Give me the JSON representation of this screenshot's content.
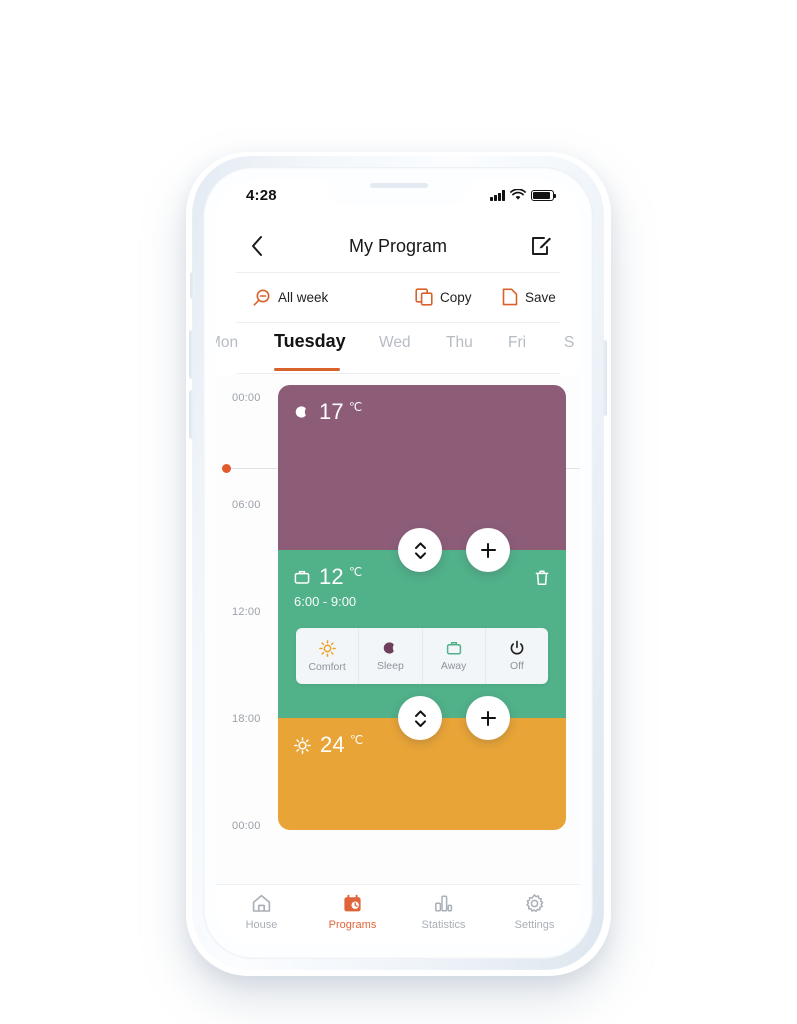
{
  "statusbar": {
    "time": "4:28",
    "signal_icon": "cellular-signal-icon",
    "wifi_icon": "wifi-icon",
    "battery_icon": "battery-icon"
  },
  "header": {
    "back_icon": "chevron-left-icon",
    "title": "My Program",
    "edit_icon": "edit-pencil-square-icon"
  },
  "toolbar": {
    "accent_color": "#d9622b",
    "items": [
      {
        "label": "All week",
        "icon": "zoom-out-magnifier-icon"
      },
      {
        "label": "Copy",
        "icon": "copy-icon"
      },
      {
        "label": "Save",
        "icon": "save-document-icon"
      }
    ]
  },
  "day_tabs": {
    "active_index": 1,
    "underline_color": "#d9622b",
    "items": [
      {
        "label": "Mon"
      },
      {
        "label": "Tuesday"
      },
      {
        "label": "Wed"
      },
      {
        "label": "Thu"
      },
      {
        "label": "Fri"
      },
      {
        "label": "S"
      }
    ]
  },
  "schedule": {
    "axis_labels": [
      "00:00",
      "06:00",
      "12:00",
      "18:00",
      "00:00"
    ],
    "now_indicator": {
      "dot_color": "#e3592a"
    },
    "blocks": [
      {
        "mode": "Sleep",
        "icon": "moon-icon",
        "temperature": "17",
        "unit": "℃",
        "color": "#8d5d78",
        "range": ""
      },
      {
        "mode": "Away",
        "icon": "briefcase-icon",
        "temperature": "12",
        "unit": "℃",
        "color": "#51b189",
        "range": "6:00 - 9:00",
        "delete_icon": "trash-icon"
      },
      {
        "mode": "Comfort",
        "icon": "sun-icon",
        "temperature": "24",
        "unit": "℃",
        "color": "#e8a437",
        "range": ""
      }
    ],
    "handles": {
      "drag_icon": "chevron-up-down-icon",
      "add_icon": "plus-icon"
    }
  },
  "mode_selector": {
    "modes": [
      {
        "label": "Comfort",
        "icon": "sun-icon",
        "color": "#f0a02a"
      },
      {
        "label": "Sleep",
        "icon": "moon-icon",
        "color": "#6e3f5c"
      },
      {
        "label": "Away",
        "icon": "briefcase-icon",
        "color": "#51b189"
      },
      {
        "label": "Off",
        "icon": "power-icon",
        "color": "#1f1f1f"
      }
    ]
  },
  "bottom_nav": {
    "active_index": 1,
    "active_color": "#e0643a",
    "items": [
      {
        "label": "House",
        "icon": "home-icon"
      },
      {
        "label": "Programs",
        "icon": "calendar-clock-icon"
      },
      {
        "label": "Statistics",
        "icon": "bar-chart-icon"
      },
      {
        "label": "Settings",
        "icon": "gear-icon"
      }
    ]
  }
}
